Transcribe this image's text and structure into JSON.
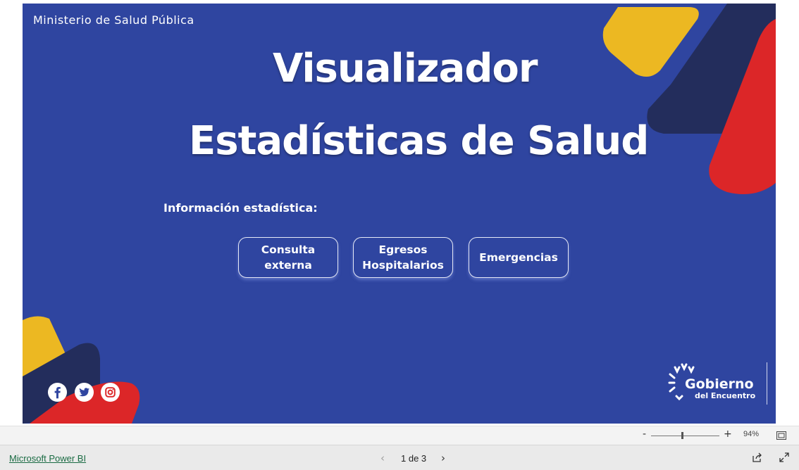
{
  "report": {
    "ministry": "Ministerio de Salud Pública",
    "title_line1": "Visualizador",
    "title_line2": "Estadísticas de Salud",
    "info_label": "Información estadística:",
    "buttons": [
      {
        "label": "Consulta\nexterna"
      },
      {
        "label": "Egresos\nHospitalarios"
      },
      {
        "label": "Emergencias"
      }
    ],
    "social_icons": [
      "facebook-icon",
      "twitter-icon",
      "instagram-icon"
    ],
    "logo": {
      "line1": "Gobierno",
      "line2": "del Encuentro"
    }
  },
  "toolbar": {
    "zoom_minus": "-",
    "zoom_plus": "+",
    "zoom_level": "94%",
    "zoom_fraction": 0.45
  },
  "footer": {
    "brand_link": "Microsoft Power BI",
    "page_indicator": "1 de 3"
  },
  "colors": {
    "background": "#2f45a0",
    "yellow": "#ecb822",
    "navy": "#232d5c",
    "red": "#dc2628",
    "text": "#ffffff"
  }
}
